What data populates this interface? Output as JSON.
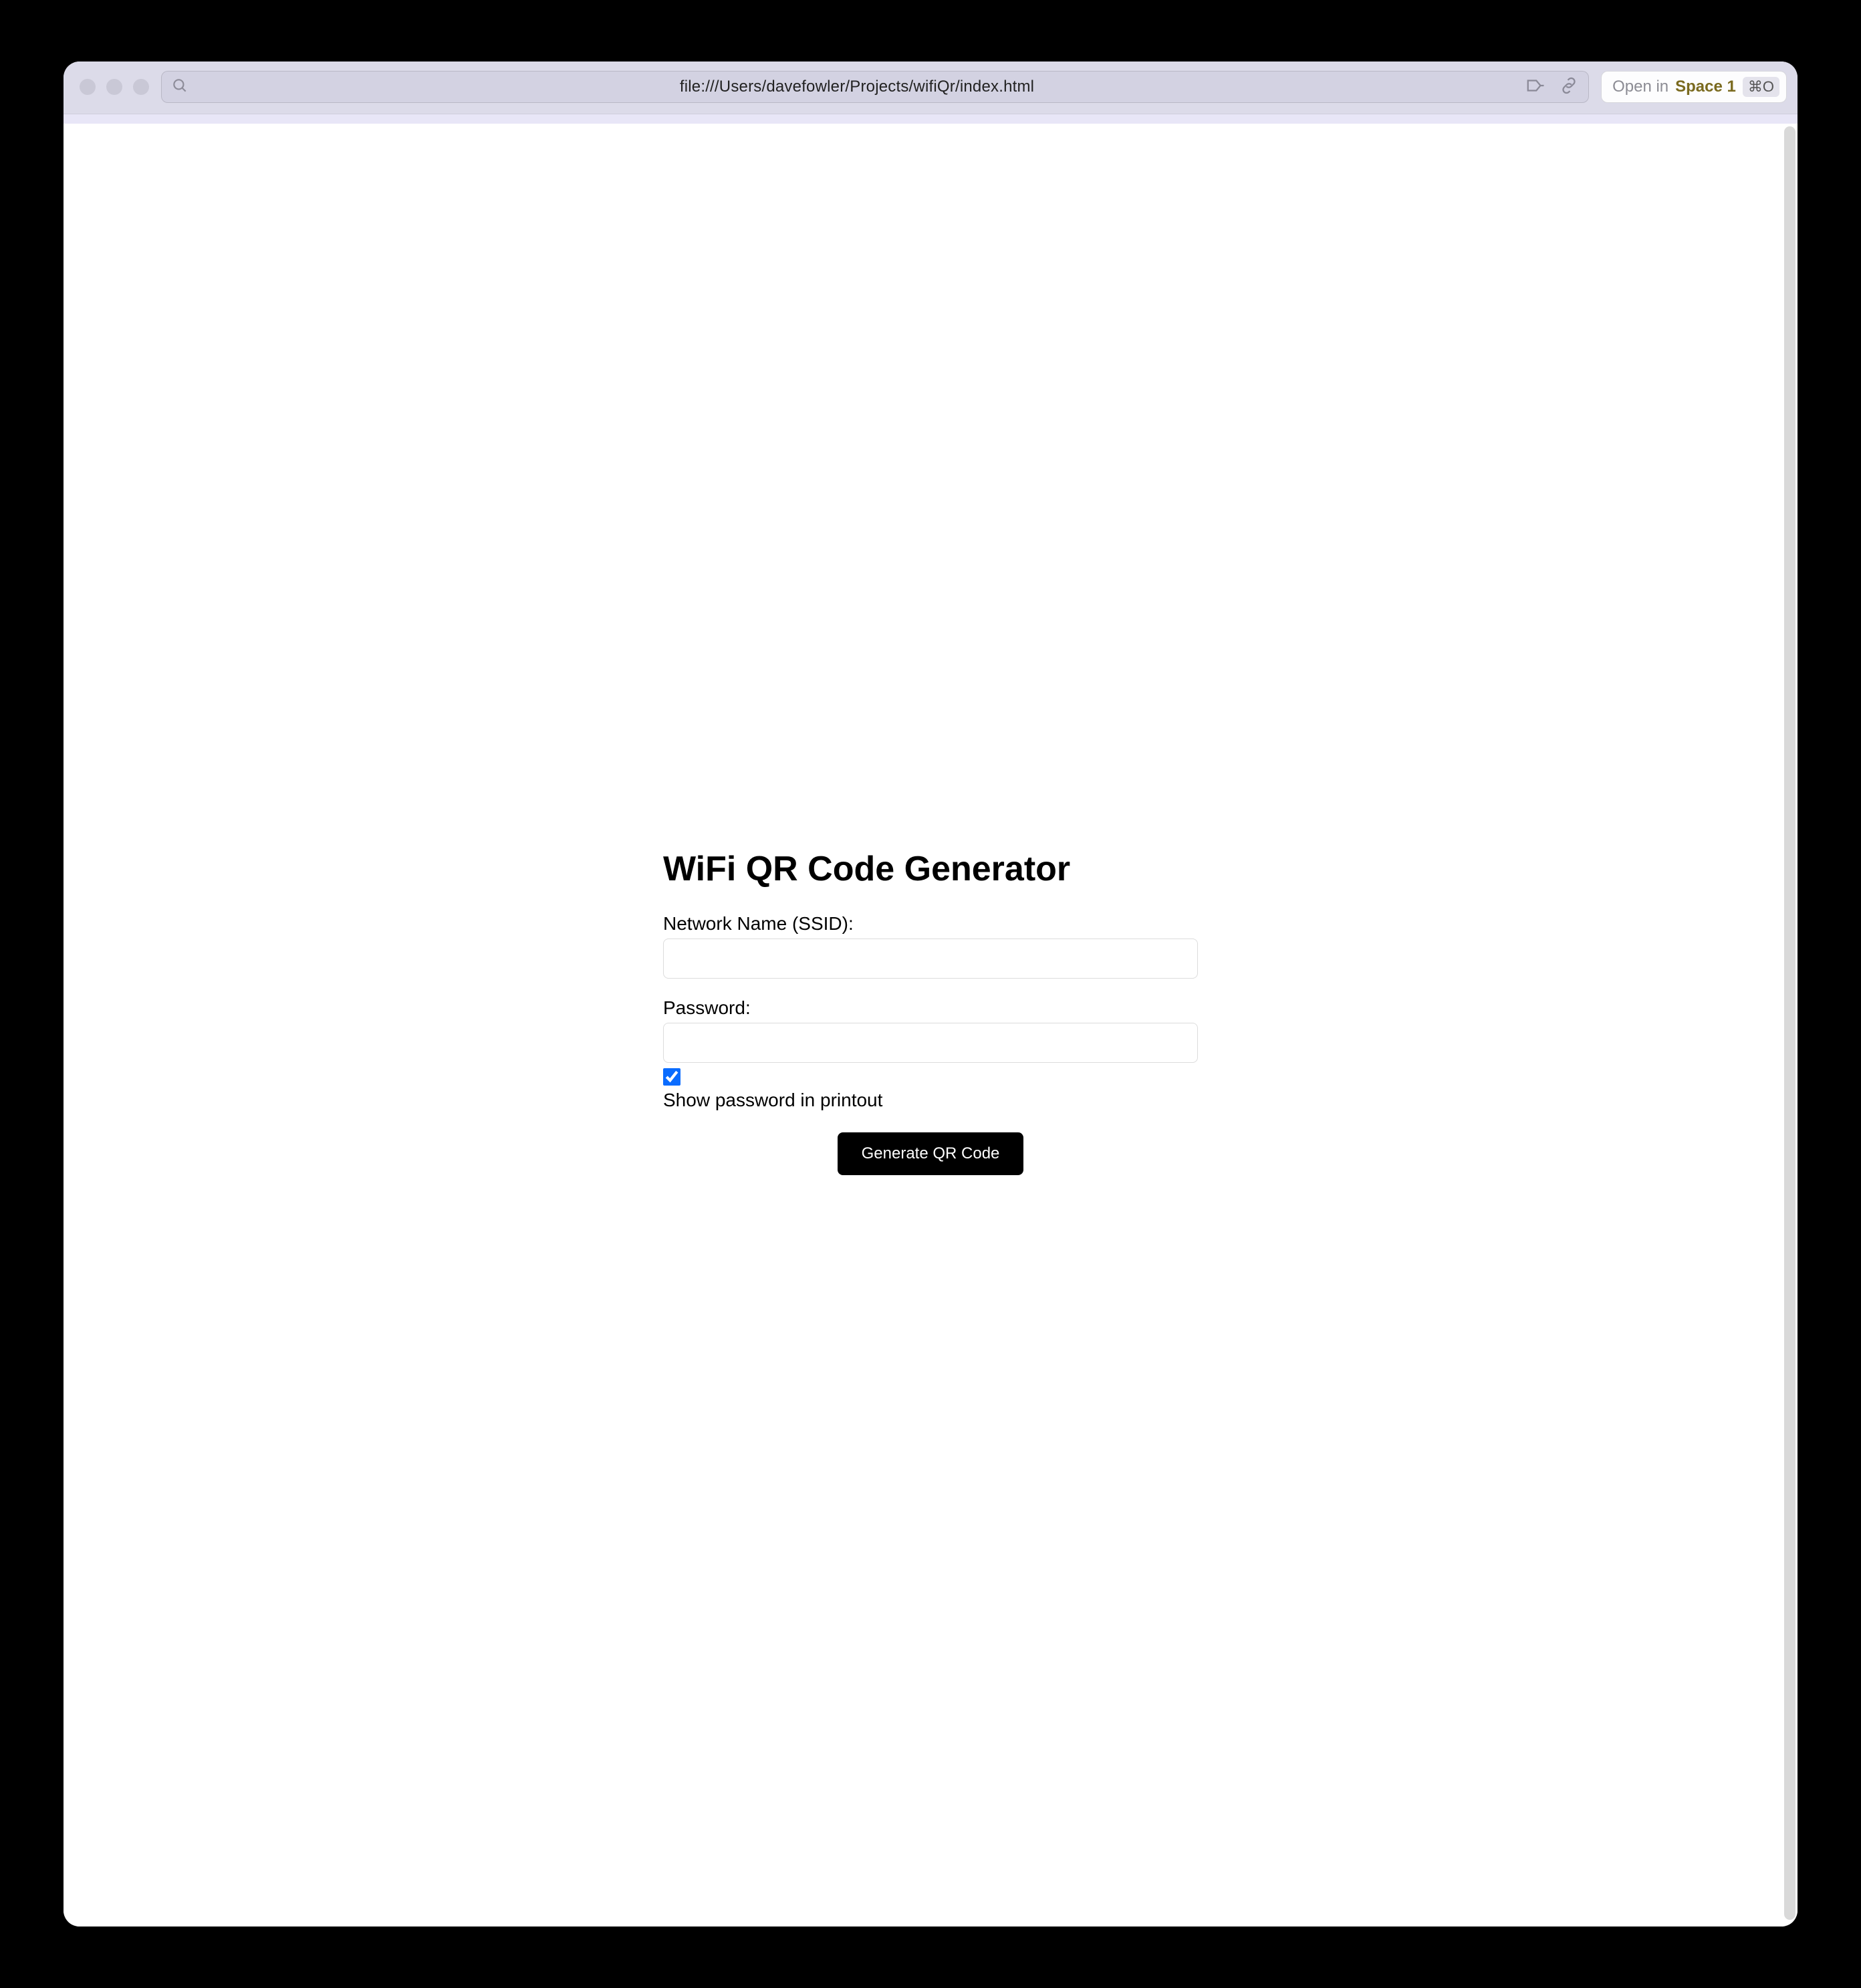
{
  "browser": {
    "address_url": "file:///Users/davefowler/Projects/wifiQr/index.html",
    "open_in_prefix": "Open in ",
    "open_in_space": "Space 1",
    "open_in_shortcut": "⌘O"
  },
  "page": {
    "title": "WiFi QR Code Generator",
    "ssid_label": "Network Name (SSID):",
    "ssid_value": "",
    "password_label": "Password:",
    "password_value": "",
    "show_password_checked": true,
    "show_password_label": "Show password in printout",
    "generate_button": "Generate QR Code"
  }
}
